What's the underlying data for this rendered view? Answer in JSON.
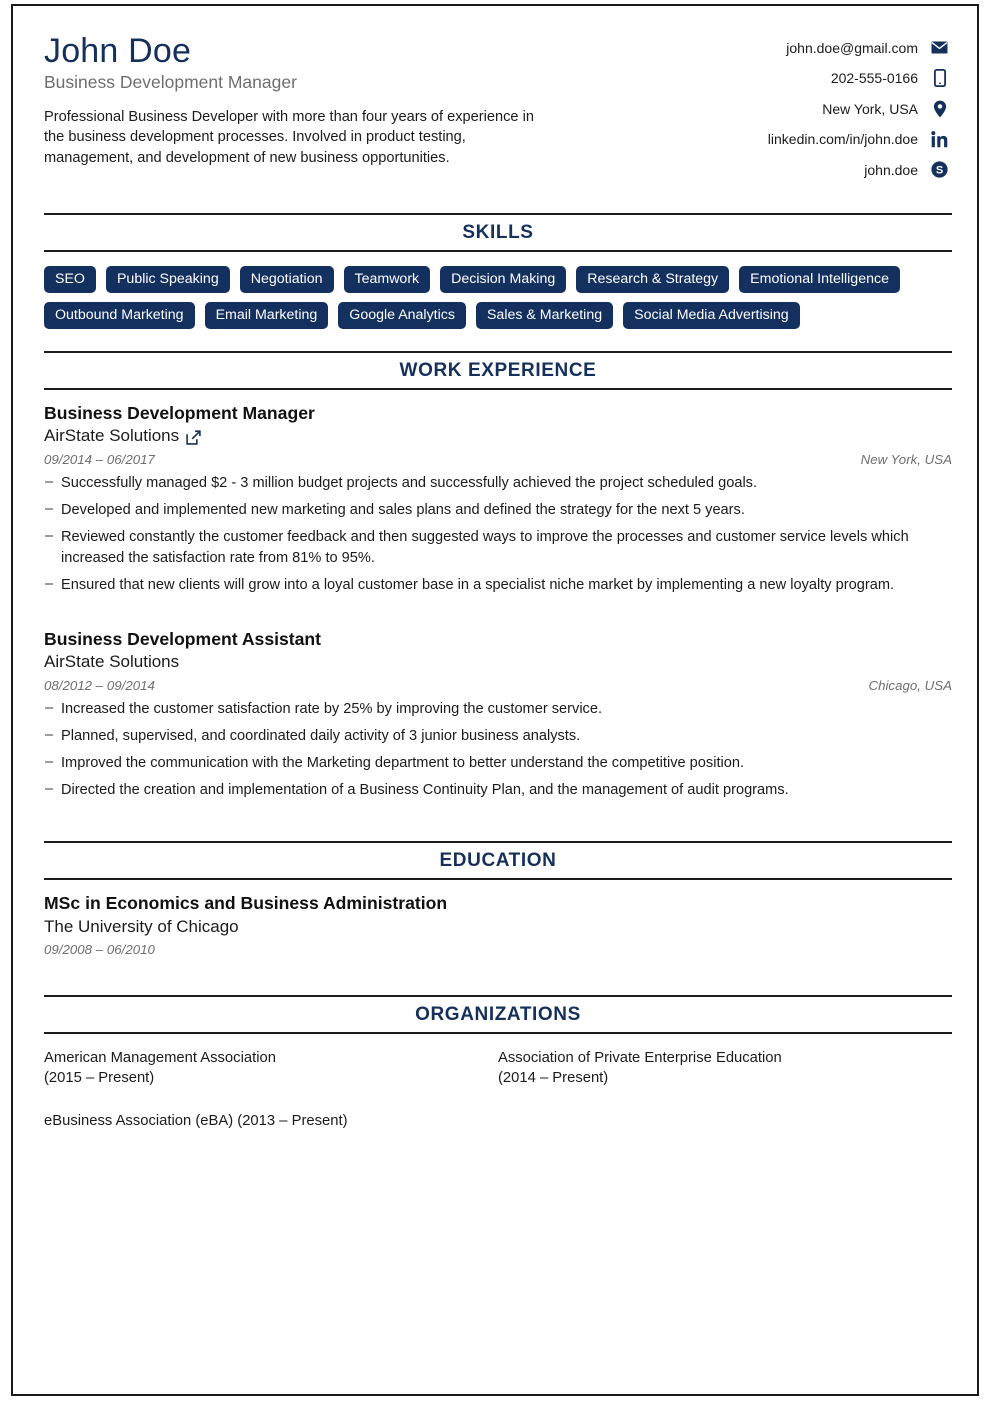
{
  "header": {
    "name": "John Doe",
    "job_title": "Business Development Manager",
    "summary": "Professional Business Developer with more than four years of experience in the business development processes. Involved in product testing, management, and development of new business opportunities.",
    "contacts": [
      {
        "text": "john.doe@gmail.com",
        "icon": "email-icon"
      },
      {
        "text": "202-555-0166",
        "icon": "phone-icon"
      },
      {
        "text": "New York, USA",
        "icon": "location-pin-icon"
      },
      {
        "text": "linkedin.com/in/john.doe",
        "icon": "linkedin-icon"
      },
      {
        "text": "john.doe",
        "icon": "skype-icon"
      }
    ]
  },
  "sections": {
    "skills": {
      "title": "SKILLS",
      "items": [
        "SEO",
        "Public Speaking",
        "Negotiation",
        "Teamwork",
        "Decision Making",
        "Research & Strategy",
        "Emotional Intelligence",
        "Outbound Marketing",
        "Email Marketing",
        "Google Analytics",
        "Sales & Marketing",
        "Social Media Advertising"
      ]
    },
    "work_experience": {
      "title": "WORK EXPERIENCE",
      "entries": [
        {
          "role": "Business Development Manager",
          "company": "AirState Solutions",
          "has_link": true,
          "date": "09/2014 – 06/2017",
          "location": "New York, USA",
          "bullets": [
            "Successfully managed $2 - 3 million budget projects and successfully achieved the project scheduled goals.",
            "Developed and implemented new marketing and sales plans and defined the strategy for the next 5 years.",
            "Reviewed constantly the customer feedback and then suggested ways to improve the processes and customer service levels which increased the satisfaction rate from 81% to 95%.",
            "Ensured that new clients will grow into a loyal customer base in a specialist niche market by implementing a new loyalty program."
          ]
        },
        {
          "role": "Business Development Assistant",
          "company": "AirState Solutions",
          "has_link": false,
          "date": "08/2012 – 09/2014",
          "location": "Chicago, USA",
          "bullets": [
            "Increased the customer satisfaction rate by 25% by improving the customer service.",
            "Planned, supervised, and coordinated daily activity of 3 junior business analysts.",
            "Improved the communication with the Marketing department to better understand the competitive position.",
            "Directed the creation and implementation of a Business Continuity Plan, and the management of audit programs."
          ]
        }
      ]
    },
    "education": {
      "title": "EDUCATION",
      "degree": "MSc in Economics and Business Administration",
      "school": "The University of Chicago",
      "date": "09/2008 – 06/2010"
    },
    "organizations": {
      "title": "ORGANIZATIONS",
      "items": [
        "American Management Association\n(2015 – Present)",
        "Association of Private Enterprise Education\n(2014 – Present)",
        "eBusiness Association (eBA) (2013 – Present)"
      ]
    }
  },
  "colors": {
    "navy": "#16305c",
    "badge_navy": "#13305f",
    "gray_text": "#6e6e6e",
    "body_text": "#1b1b1b",
    "rule": "#1c1c1c"
  }
}
